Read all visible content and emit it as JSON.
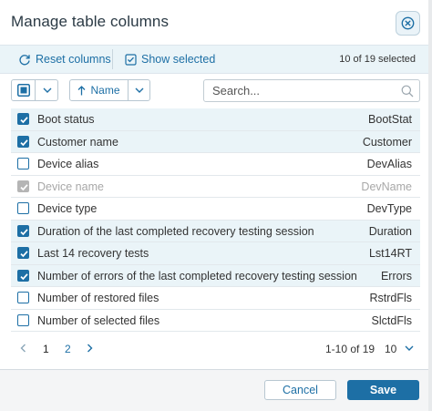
{
  "dialog": {
    "title": "Manage table columns",
    "close_icon": "close-circle-icon"
  },
  "toolbar": {
    "reset_label": "Reset columns",
    "reset_icon": "refresh-icon",
    "show_selected_label": "Show selected",
    "show_selected_icon": "checkbox-list-icon",
    "selected_count": "10 of 19 selected"
  },
  "controls": {
    "select_all_icon": "partial-check-icon",
    "sort_label": "Name",
    "sort_icon": "arrow-up-icon",
    "search_placeholder": "Search...",
    "search_value": ""
  },
  "columns": [
    {
      "name": "Boot status",
      "short": "BootStat",
      "state": "checked"
    },
    {
      "name": "Customer name",
      "short": "Customer",
      "state": "checked"
    },
    {
      "name": "Device alias",
      "short": "DevAlias",
      "state": "unchecked"
    },
    {
      "name": "Device name",
      "short": "DevName",
      "state": "disabled"
    },
    {
      "name": "Device type",
      "short": "DevType",
      "state": "unchecked"
    },
    {
      "name": "Duration of the last completed recovery testing session",
      "short": "Duration",
      "state": "checked"
    },
    {
      "name": "Last 14 recovery tests",
      "short": "Lst14RT",
      "state": "checked"
    },
    {
      "name": "Number of errors of the last completed recovery testing session",
      "short": "Errors",
      "state": "checked"
    },
    {
      "name": "Number of restored files",
      "short": "RstrdFls",
      "state": "unchecked"
    },
    {
      "name": "Number of selected files",
      "short": "SlctdFls",
      "state": "unchecked"
    }
  ],
  "pagination": {
    "pages": [
      "1",
      "2"
    ],
    "current_page": "1",
    "range": "1-10 of 19",
    "per_page": "10"
  },
  "footer": {
    "cancel_label": "Cancel",
    "save_label": "Save"
  },
  "colors": {
    "accent": "#1d6fa5",
    "selected_row": "#eaf4f8",
    "disabled": "#a8a8a8"
  }
}
